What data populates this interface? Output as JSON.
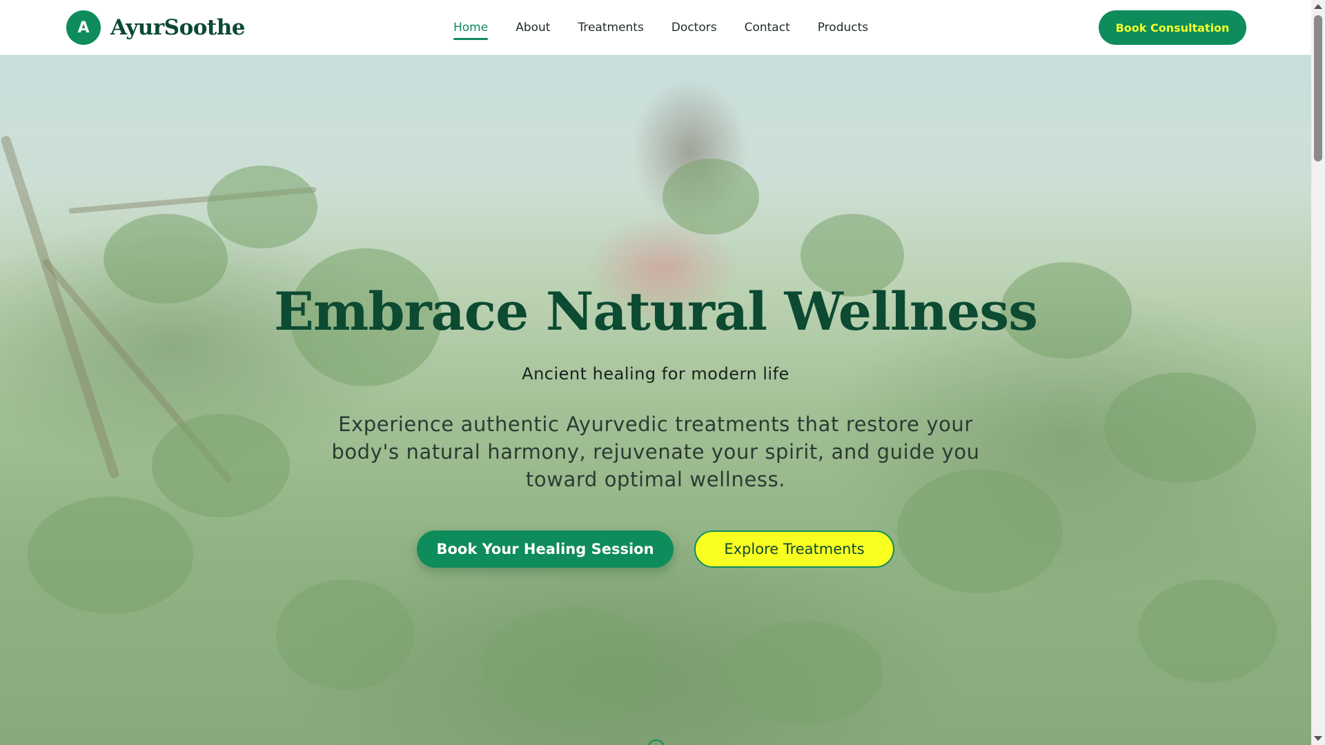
{
  "brand": {
    "logo_letter": "A",
    "name": "AyurSoothe"
  },
  "nav": {
    "items": [
      {
        "label": "Home",
        "active": true
      },
      {
        "label": "About",
        "active": false
      },
      {
        "label": "Treatments",
        "active": false
      },
      {
        "label": "Doctors",
        "active": false
      },
      {
        "label": "Contact",
        "active": false
      },
      {
        "label": "Products",
        "active": false
      }
    ]
  },
  "header": {
    "cta_label": "Book Consultation"
  },
  "hero": {
    "title": "Embrace Natural Wellness",
    "subtitle": "Ancient healing for modern life",
    "description": "Experience authentic Ayurvedic treatments that restore your body's natural harmony, rejuvenate your spirit, and guide you toward optimal wellness.",
    "primary_button": "Book Your Healing Session",
    "secondary_button": "Explore Treatments",
    "background_image": "clover-field-icon"
  },
  "colors": {
    "brand_green": "#0e8c5b",
    "dark_green": "#0c4a32",
    "accent_yellow": "#f9ff21"
  }
}
